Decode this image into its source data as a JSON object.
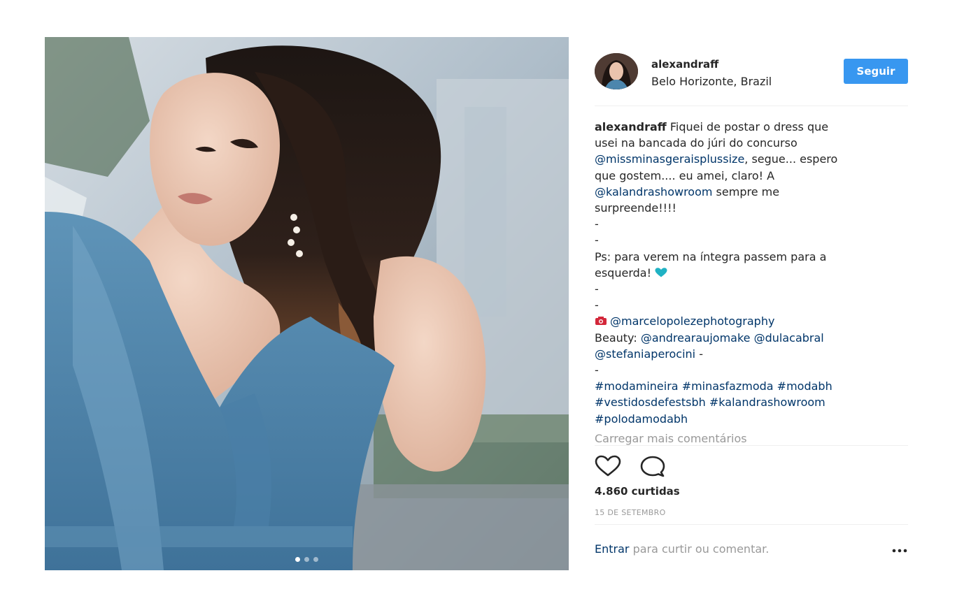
{
  "post": {
    "username": "alexandraff",
    "location": "Belo Horizonte, Brazil",
    "follow_label": "Seguir",
    "carousel": {
      "count": 3,
      "active_index": 0
    },
    "caption_lines": [
      {
        "parts": [
          {
            "text": "alexandraff",
            "style": "bold"
          },
          {
            "text": " Fiquei de postar o dress que",
            "style": "text"
          }
        ]
      },
      {
        "parts": [
          {
            "text": "usei na bancada do júri do concurso",
            "style": "text"
          }
        ]
      },
      {
        "parts": [
          {
            "text": "@missminasgeraisplussize",
            "style": "link"
          },
          {
            "text": ", segue... espero",
            "style": "text"
          }
        ]
      },
      {
        "parts": [
          {
            "text": "que gostem.... eu amei, claro! A",
            "style": "text"
          }
        ]
      },
      {
        "parts": [
          {
            "text": "@kalandrashowroom",
            "style": "link"
          },
          {
            "text": " sempre me",
            "style": "text"
          }
        ]
      },
      {
        "parts": [
          {
            "text": "surpreende!!!!",
            "style": "text"
          }
        ]
      },
      {
        "parts": [
          {
            "text": "-",
            "style": "text"
          }
        ]
      },
      {
        "parts": [
          {
            "text": "-",
            "style": "text"
          }
        ]
      },
      {
        "parts": [
          {
            "text": "Ps: para verem na íntegra passem para a",
            "style": "text"
          }
        ]
      },
      {
        "parts": [
          {
            "text": "esquerda! ",
            "style": "text"
          },
          {
            "icon": "teal-heart-emoji"
          }
        ]
      },
      {
        "parts": [
          {
            "text": "-",
            "style": "text"
          }
        ]
      },
      {
        "parts": [
          {
            "text": "-",
            "style": "text"
          }
        ]
      },
      {
        "parts": [
          {
            "icon": "camera-emoji"
          },
          {
            "text": "@marcelopolezephotography",
            "style": "link"
          }
        ]
      },
      {
        "parts": [
          {
            "text": "Beauty: ",
            "style": "text"
          },
          {
            "text": "@andrearaujomake",
            "style": "link"
          },
          {
            "text": " ",
            "style": "text"
          },
          {
            "text": "@dulacabral",
            "style": "link"
          }
        ]
      },
      {
        "parts": [
          {
            "text": "@stefaniaperocini",
            "style": "link"
          },
          {
            "text": " -",
            "style": "text"
          }
        ]
      },
      {
        "parts": [
          {
            "text": "-",
            "style": "text"
          }
        ]
      },
      {
        "parts": [
          {
            "text": "#modamineira",
            "style": "link"
          },
          {
            "text": " ",
            "style": "text"
          },
          {
            "text": "#minasfazmoda",
            "style": "link"
          },
          {
            "text": " ",
            "style": "text"
          },
          {
            "text": "#modabh",
            "style": "link"
          }
        ]
      },
      {
        "parts": [
          {
            "text": "#vestidosdefestsbh",
            "style": "link"
          },
          {
            "text": " ",
            "style": "text"
          },
          {
            "text": "#kalandrashowroom",
            "style": "link"
          }
        ]
      },
      {
        "parts": [
          {
            "text": "#polodamodabh",
            "style": "link"
          }
        ]
      }
    ],
    "load_more_label": "Carregar mais comentários",
    "likes": "4.860 curtidas",
    "date": "15 DE SETEMBRO",
    "login_link": "Entrar",
    "login_text": " para curtir ou comentar.",
    "icons": {
      "like": "heart-outline-icon",
      "comment": "comment-bubble-icon",
      "more": "more-options-icon"
    },
    "colors": {
      "follow_button": "#3897f0",
      "link": "#003569",
      "muted": "#999999",
      "text": "#262626",
      "heart_emoji": "#20b2c4",
      "camera_emoji": "#d3273a"
    }
  }
}
